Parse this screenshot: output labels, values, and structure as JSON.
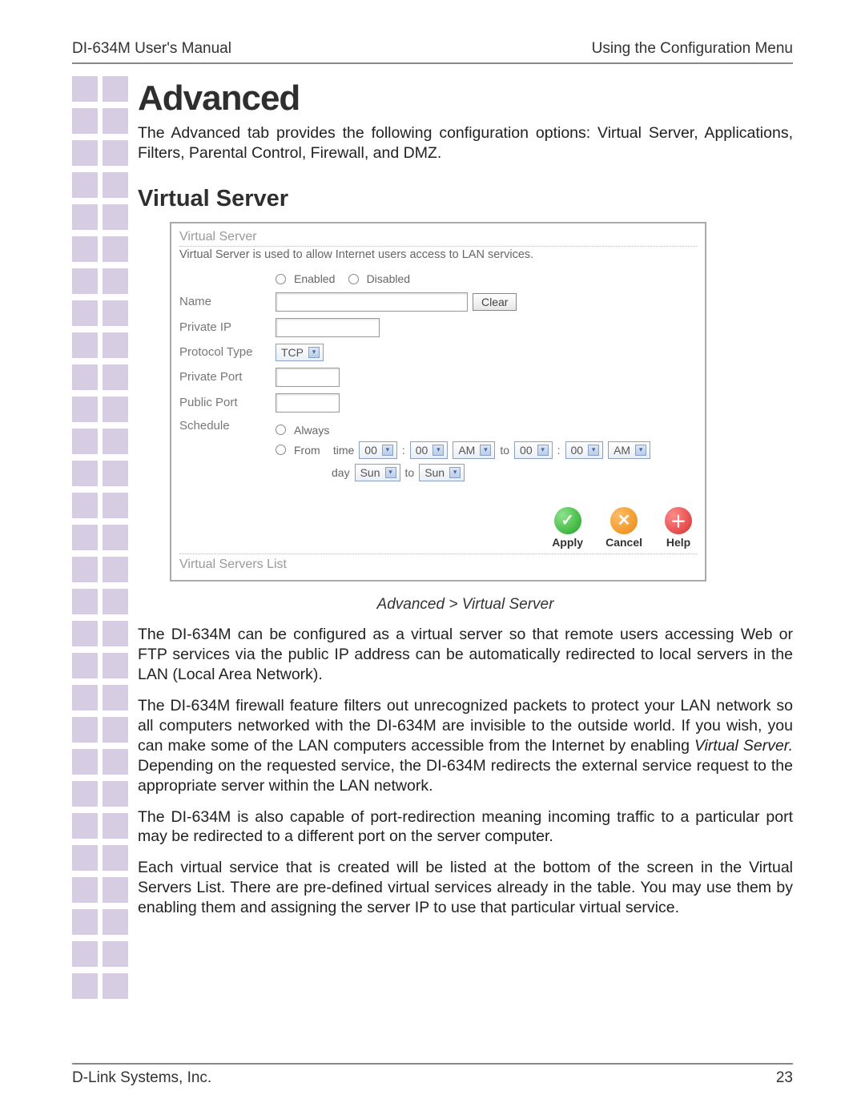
{
  "header": {
    "left": "DI-634M User's Manual",
    "right": "Using the Configuration Menu"
  },
  "title_section": "Advanced",
  "intro": "The Advanced tab provides the following configuration options: Virtual Server, Applications, Filters, Parental Control, Firewall, and DMZ.",
  "subsection": "Virtual Server",
  "screenshot": {
    "heading": "Virtual Server",
    "description": "Virtual Server is used to allow Internet users access to LAN services.",
    "enabled_label": "Enabled",
    "disabled_label": "Disabled",
    "labels": {
      "name": "Name",
      "private_ip": "Private IP",
      "protocol_type": "Protocol Type",
      "private_port": "Private Port",
      "public_port": "Public Port",
      "schedule": "Schedule"
    },
    "clear_btn": "Clear",
    "protocol_value": "TCP",
    "schedule": {
      "always": "Always",
      "from": "From",
      "time": "time",
      "hh1": "00",
      "mm1": "00",
      "ampm1": "AM",
      "to": "to",
      "hh2": "00",
      "mm2": "00",
      "ampm2": "AM",
      "day": "day",
      "day1": "Sun",
      "day2": "Sun"
    },
    "list_heading": "Virtual Servers List",
    "actions": {
      "apply": "Apply",
      "cancel": "Cancel",
      "help": "Help"
    }
  },
  "breadcrumb_caption": "Advanced > Virtual Server",
  "paragraphs": {
    "p1": "The DI-634M can be configured as a virtual server so that remote users accessing Web or FTP services via the public IP address can be automatically redirected to local servers in the LAN (Local Area Network).",
    "p2a": "The DI-634M firewall feature filters out unrecognized packets to protect your LAN network so all computers networked with the DI-634M are invisible to the outside world. If you wish, you can make some of the LAN computers accessible from the Internet by enabling ",
    "p2b_em": "Virtual Server.",
    "p2c": " Depending on the requested service, the DI-634M redirects the external service request to the appropriate server within the LAN network.",
    "p3": "The DI-634M is also capable of port-redirection meaning incoming traffic to a particular port may be redirected to a different port on the server computer.",
    "p4": "Each virtual service that is created will be listed at the bottom of the screen in the Virtual Servers List. There are pre-defined virtual services already in the table. You may use them by enabling them and assigning the server IP to use that particular virtual service."
  },
  "footer": {
    "left": "D-Link Systems, Inc.",
    "right": "23"
  }
}
